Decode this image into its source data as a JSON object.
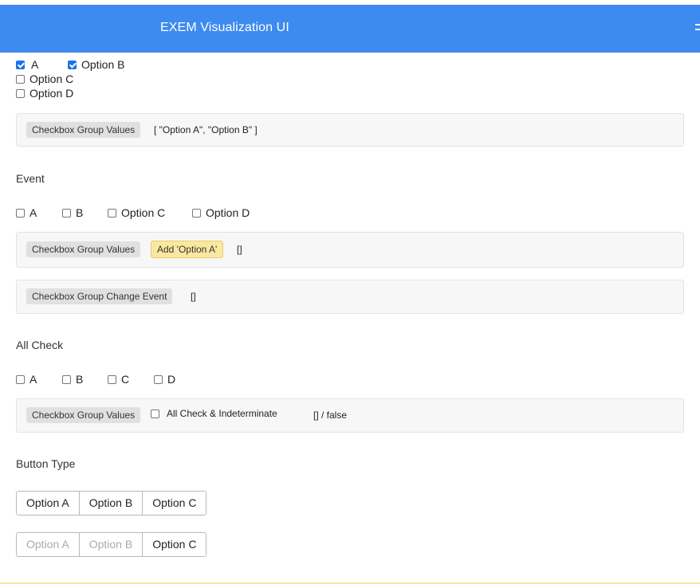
{
  "header": {
    "title": "EXEM Visualization UI"
  },
  "group1": {
    "options": [
      {
        "label": "A",
        "checked": true
      },
      {
        "label": "Option B",
        "checked": true
      },
      {
        "label": "Option C",
        "checked": false
      },
      {
        "label": "Option D",
        "checked": false
      }
    ],
    "panel": {
      "tag": "Checkbox Group Values",
      "value": "[ \"Option A\", \"Option B\" ]"
    }
  },
  "event": {
    "title": "Event",
    "options": [
      {
        "label": "A",
        "checked": false
      },
      {
        "label": "B",
        "checked": false
      },
      {
        "label": "Option C",
        "checked": false
      },
      {
        "label": "Option D",
        "checked": false
      }
    ],
    "panel1": {
      "tag": "Checkbox Group Values",
      "button": "Add 'Option A'",
      "value": "[]"
    },
    "panel2": {
      "tag": "Checkbox Group Change Event",
      "value": "[]"
    }
  },
  "all_check": {
    "title": "All Check",
    "options": [
      {
        "label": "A",
        "checked": false
      },
      {
        "label": "B",
        "checked": false
      },
      {
        "label": "C",
        "checked": false
      },
      {
        "label": "D",
        "checked": false
      }
    ],
    "panel": {
      "tag": "Checkbox Group Values",
      "checkbox_label": "All Check & Indeterminate",
      "value": "[] / false"
    }
  },
  "button_type": {
    "title": "Button Type",
    "row1": [
      {
        "label": "Option A",
        "disabled": false
      },
      {
        "label": "Option B",
        "disabled": false
      },
      {
        "label": "Option C",
        "disabled": false
      }
    ],
    "row2": [
      {
        "label": "Option A",
        "disabled": true
      },
      {
        "label": "Option B",
        "disabled": true
      },
      {
        "label": "Option C",
        "disabled": false
      }
    ]
  },
  "colors": {
    "header_bg": "#3d8af0",
    "checkbox_checked": "#1a73e8",
    "tag_yellow": "#fbe8a0"
  }
}
